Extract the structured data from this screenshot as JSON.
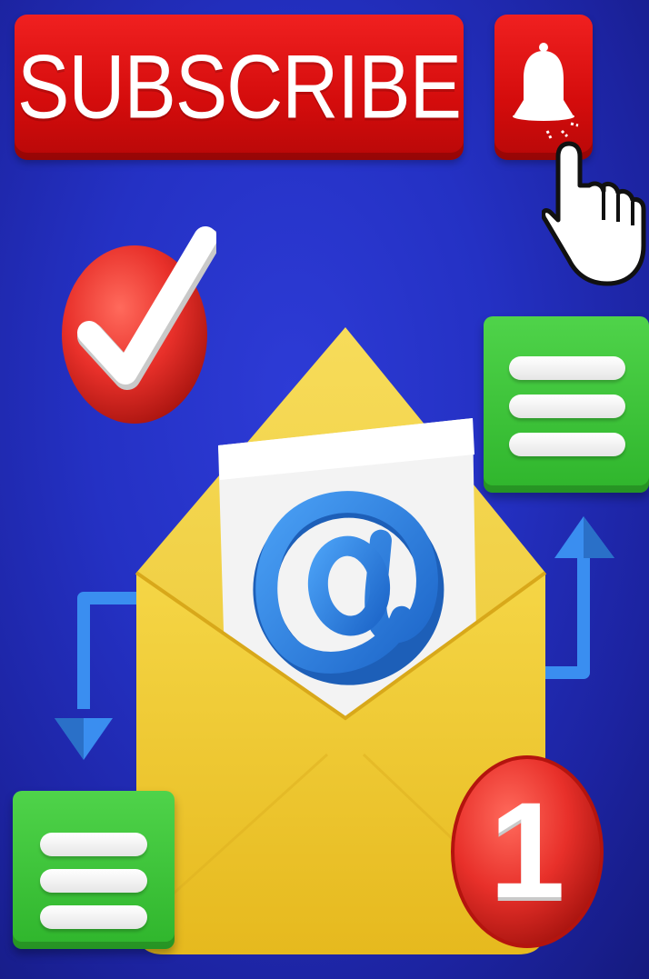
{
  "subscribe_button": {
    "label": "SUBSCRIBE"
  },
  "icons": {
    "bell": "bell-icon",
    "pointer": "hand-pointer-icon",
    "checkmark": "checkmark-icon",
    "envelope": "envelope-icon",
    "at_sign": "at-sign-icon",
    "list": "list-icon",
    "arrow_down": "arrow-down-icon",
    "arrow_up": "arrow-up-icon"
  },
  "notification_badge": {
    "count": "1"
  },
  "colors": {
    "background": "#2431c4",
    "subscribe_red": "#e01414",
    "badge_red": "#e8302a",
    "card_green": "#3bc437",
    "envelope_yellow": "#f2cf3a",
    "at_blue": "#2f7fe0",
    "arrow_blue": "#3a8ef0"
  }
}
